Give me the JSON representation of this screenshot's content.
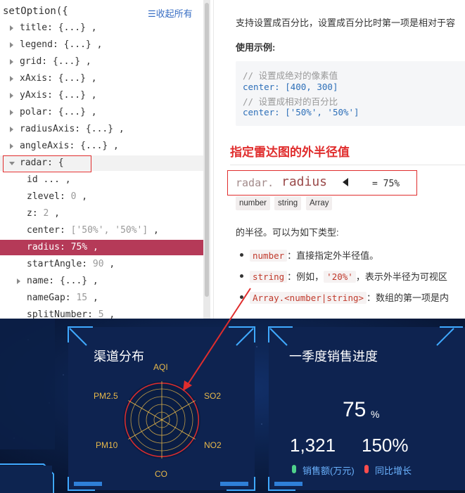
{
  "tree": {
    "root": "setOption({",
    "collapse_all": "☰收起所有",
    "rows": [
      {
        "label": "title: {...} ,"
      },
      {
        "label": "legend: {...} ,"
      },
      {
        "label": "grid: {...} ,"
      },
      {
        "label": "xAxis: {...} ,"
      },
      {
        "label": "yAxis: {...} ,"
      },
      {
        "label": "polar: {...} ,"
      },
      {
        "label": "radiusAxis: {...} ,"
      },
      {
        "label": "angleAxis: {...} ,"
      },
      {
        "label": "radar: {"
      },
      {
        "label": "id ... ,"
      },
      {
        "key": "zlevel:",
        "val": "0",
        "end": ","
      },
      {
        "key": "z:",
        "val": "2",
        "end": ","
      },
      {
        "key": "center:",
        "val": "['50%', '50%']",
        "end": ","
      },
      {
        "key": "radius:",
        "val": "75%",
        "end": ","
      },
      {
        "key": "startAngle:",
        "val": "90",
        "end": ","
      },
      {
        "label": "name: {...} ,"
      },
      {
        "key": "nameGap:",
        "val": "15",
        "end": ","
      },
      {
        "key": "splitNumber:",
        "val": "5",
        "end": ","
      }
    ]
  },
  "doc": {
    "intro": "支持设置成百分比，设置成百分比时第一项是相对于容",
    "usage_title": "使用示例:",
    "code": {
      "c1": "// 设置成绝对的像素值",
      "l1_key": "center",
      "l1_val": ": [400, 300]",
      "c2": "// 设置成相对的百分比",
      "l2_key": "center",
      "l2_val": ": ['50%', '50%']"
    },
    "heading": "指定雷达图的外半径值",
    "prop_prefix": "radar.",
    "prop_name": "radius",
    "prop_value": "= 75%",
    "types": [
      "number",
      "string",
      "Array"
    ],
    "desc": "的半径。可以为如下类型:",
    "bullets": [
      {
        "code": "number",
        "text": "：直接指定外半径值。"
      },
      {
        "code": "string",
        "text": "：例如，",
        "code2": "'20%'",
        "text2": "，表示外半径为可视区"
      },
      {
        "code": "Array.<number|string>",
        "text": "：数组的第一项是内"
      }
    ]
  },
  "dashboard": {
    "panel1": {
      "title": "渠道分布",
      "indicators": [
        "AQI",
        "SO2",
        "NO2",
        "CO",
        "PM10",
        "PM2.5"
      ]
    },
    "panel2": {
      "title": "一季度销售进度",
      "percent": "75",
      "percent_unit": "%",
      "sales": "1,321",
      "growth": "150%",
      "legend": [
        {
          "label": "销售额(万元)",
          "color": "#4fd18b"
        },
        {
          "label": "同比增长",
          "color": "#ff4d4d"
        }
      ]
    }
  },
  "colors": {
    "highlight": "#b53a58",
    "annotation_red": "#e02d2d",
    "dash_bg": "#0b1a3e",
    "radar_gold": "#e8b94a"
  }
}
